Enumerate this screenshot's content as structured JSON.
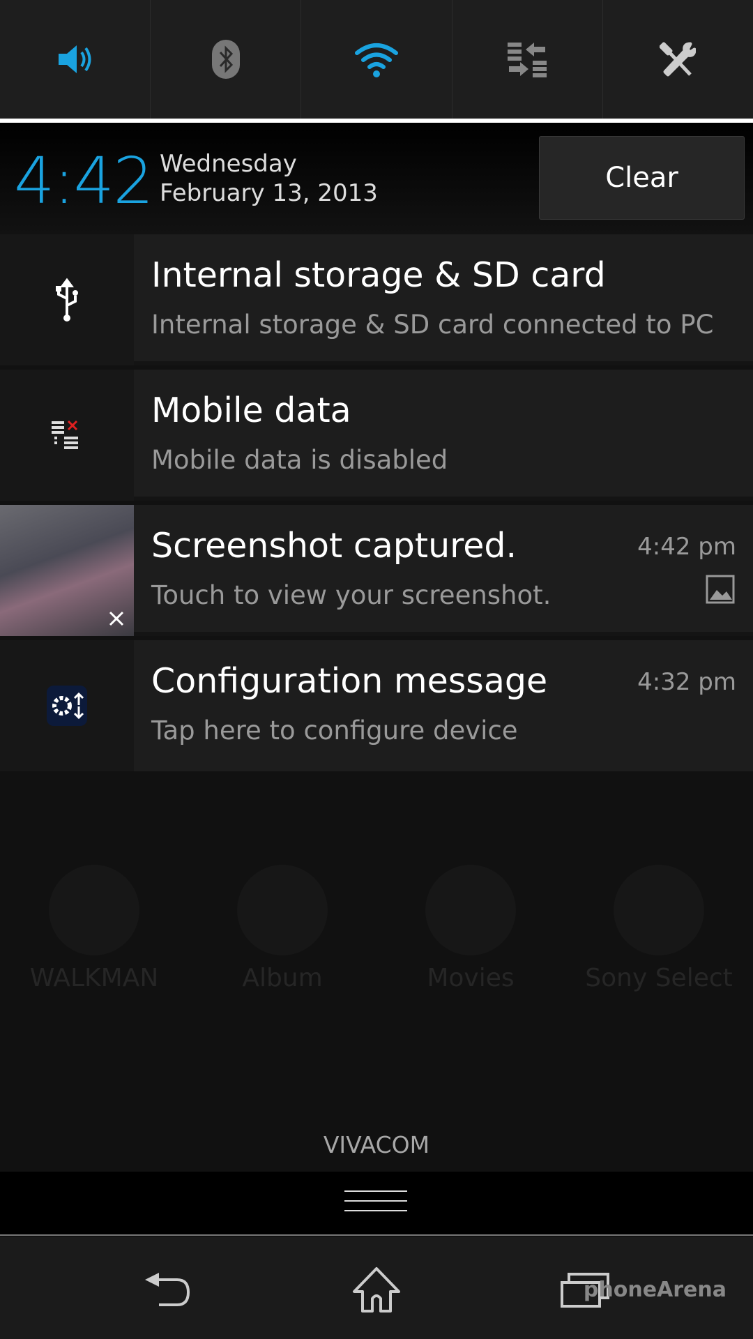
{
  "quick_settings": [
    {
      "name": "sound",
      "icon": "speaker-icon",
      "active": true
    },
    {
      "name": "bluetooth",
      "icon": "bluetooth-icon",
      "active": false
    },
    {
      "name": "wifi",
      "icon": "wifi-icon",
      "active": true
    },
    {
      "name": "data-sync",
      "icon": "data-transfer-icon",
      "active": false
    },
    {
      "name": "settings",
      "icon": "tools-icon",
      "active": false
    }
  ],
  "header": {
    "time": "4:42",
    "day": "Wednesday",
    "date": "February 13, 2013",
    "clear_label": "Clear"
  },
  "notifications": [
    {
      "title": "Internal storage & SD card",
      "subtitle": "Internal storage & SD card connected to PC",
      "time": "",
      "icon": "usb-icon"
    },
    {
      "title": "Mobile data",
      "subtitle": "Mobile data is disabled",
      "time": "",
      "icon": "mobile-data-disabled-icon"
    },
    {
      "title": "Screenshot captured.",
      "subtitle": "Touch to view your screenshot.",
      "time": "4:42 pm",
      "icon": "screenshot-thumbnail"
    },
    {
      "title": "Configuration message",
      "subtitle": "Tap here to configure device",
      "time": "4:32 pm",
      "icon": "config-gear-icon"
    }
  ],
  "background_apps": [
    "WALKMAN",
    "Album",
    "Movies",
    "Sony Select"
  ],
  "carrier": "VIVACOM",
  "watermark": "phoneArena",
  "colors": {
    "accent": "#1aa3e0",
    "panel": "#1d1d1d"
  }
}
